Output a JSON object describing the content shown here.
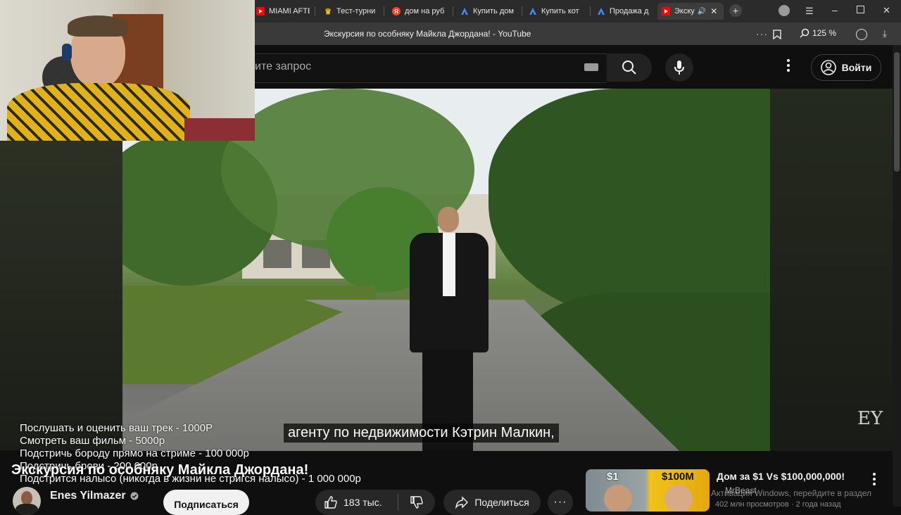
{
  "browser": {
    "tabs": [
      {
        "label": "MIAMI AFTE",
        "fav_color": "#ff0000"
      },
      {
        "label": "Тест-турни",
        "fav_color": "#f4c20d"
      },
      {
        "label": "дом на руб",
        "fav_color": "#fc3f1d",
        "fav_letter": "Я"
      },
      {
        "label": "Купить дом",
        "fav_color": "#1a73e8"
      },
      {
        "label": "Купить кот",
        "fav_color": "#1a73e8"
      },
      {
        "label": "Продажа д",
        "fav_color": "#1a73e8"
      },
      {
        "label": "Экску",
        "fav_color": "#ff0000"
      }
    ],
    "page_title": "Экскурсия по особняку Майкла Джордана! - YouTube",
    "zoom": "125 %"
  },
  "youtube": {
    "search_placeholder": "ите запрос",
    "login_label": "Войти",
    "subtitle": "агенту по недвижимости Кэтрин Малкин,",
    "watermark": "EY",
    "video_title": "Экскурсия по особняку Майкла Джордана!",
    "channel_name": "Enes Yilmazer",
    "subscribe_label": "Подписаться",
    "likes": "183 тыс.",
    "share_label": "Поделиться",
    "recommended": {
      "title": "Дом за $1 Vs $100,000,000!",
      "thumb_left": "$1",
      "thumb_right": "$100M",
      "channel": "MrBeast",
      "views": "402 млн просмотров · 2 года назад"
    }
  },
  "stream_overlay": {
    "donation_lines": [
      "Послушать и оценить ваш трек - 1000Р",
      "Смотреть ваш фильм - 5000р",
      "Подстричь бороду прямо на стриме - 100 000р",
      "Подстричь брови - 200 000р",
      "Подстрится налысо (никогда в жизни не стригся налысо) - 1 000 000р"
    ]
  },
  "os": {
    "activate_windows": "Активация Windows, перейдите в раздел"
  }
}
